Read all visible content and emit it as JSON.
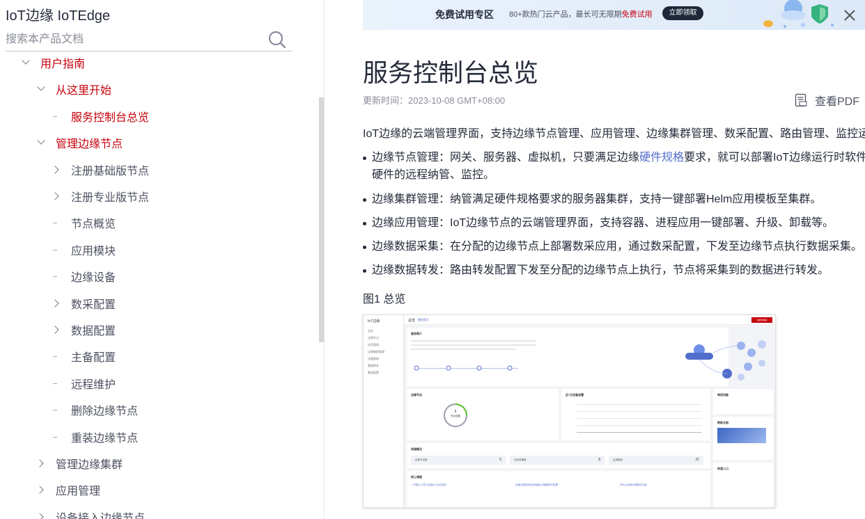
{
  "sidebar": {
    "product_title": "IoT边缘 IoTEdge",
    "search_placeholder": "搜索本产品文档",
    "items": [
      {
        "label": "用户指南",
        "state": "expanded",
        "level": 1,
        "active": true
      },
      {
        "label": "从这里开始",
        "state": "expanded",
        "level": 2,
        "active": true
      },
      {
        "label": "服务控制台总览",
        "state": "leaf",
        "level": 3,
        "active": true
      },
      {
        "label": "管理边缘节点",
        "state": "expanded",
        "level": 2,
        "active": true
      },
      {
        "label": "注册基础版节点",
        "state": "collapsed",
        "level": 3,
        "active": false
      },
      {
        "label": "注册专业版节点",
        "state": "collapsed",
        "level": 3,
        "active": false
      },
      {
        "label": "节点概览",
        "state": "leaf",
        "level": 3,
        "active": false
      },
      {
        "label": "应用模块",
        "state": "leaf",
        "level": 3,
        "active": false
      },
      {
        "label": "边缘设备",
        "state": "leaf",
        "level": 3,
        "active": false
      },
      {
        "label": "数采配置",
        "state": "collapsed",
        "level": 3,
        "active": false
      },
      {
        "label": "数据配置",
        "state": "collapsed",
        "level": 3,
        "active": false
      },
      {
        "label": "主备配置",
        "state": "leaf",
        "level": 3,
        "active": false
      },
      {
        "label": "远程维护",
        "state": "leaf",
        "level": 3,
        "active": false
      },
      {
        "label": "删除边缘节点",
        "state": "leaf",
        "level": 3,
        "active": false
      },
      {
        "label": "重装边缘节点",
        "state": "leaf",
        "level": 3,
        "active": false
      },
      {
        "label": "管理边缘集群",
        "state": "collapsed",
        "level": 2,
        "active": false
      },
      {
        "label": "应用管理",
        "state": "collapsed",
        "level": 2,
        "active": false
      },
      {
        "label": "设备接入边缘节点",
        "state": "collapsed",
        "level": 2,
        "active": false
      }
    ]
  },
  "promo": {
    "title": "免费试用专区",
    "desc_prefix": "80+款热门云产品，最长可无限期",
    "desc_highlight": "免费试用",
    "button": "立即领取"
  },
  "article": {
    "title": "服务控制台总览",
    "update_time": "更新时间：2023-10-08 GMT+08:00",
    "pdf_label": "查看PDF",
    "intro": "IoT边缘的云端管理界面，支持边缘节点管理、应用管理、边缘集群管理、数采配置、路由管理、监控运维",
    "bullets": [
      {
        "before": "边缘节点管理：网关、服务器、虚拟机，只要满足边缘",
        "link": "硬件规格",
        "after": "要求，就可以部署IoT边缘运行时软件，",
        "line2": "硬件的远程纳管、监控。"
      },
      {
        "before": "边缘集群管理：纳管满足硬件规格要求的服务器集群，支持一键部署Helm应用模板至集群。"
      },
      {
        "before": "边缘应用管理：IoT边缘节点的云端管理界面，支持容器、进程应用一键部署、升级、卸载等。"
      },
      {
        "before": "边缘数据采集：在分配的边缘节点上部署数采应用，通过数采配置，下发至边缘节点执行数据采集。"
      },
      {
        "before": "边缘数据转发：路由转发配置下发至分配的边缘节点上执行，节点将采集到的数据进行转发。"
      }
    ],
    "figure_caption": "图1 总览"
  },
  "figure": {
    "side_title": "IoT边缘",
    "side_items": [
      "总览",
      "边缘节点",
      "应用管理",
      "边缘集群管理",
      "设备管理",
      "数据转发",
      "数采配置"
    ],
    "head_title": "总览",
    "head_sub": "服务简介",
    "head_button": "免费体验版",
    "card_intro": "服务简介",
    "card_nodes": "边缘节点",
    "card_nodes_count": "5",
    "card_nodes_unit": "节点总数",
    "card_trend": "近7日设备告警",
    "card_usage": "资源概况",
    "stats": [
      {
        "label": "边缘节点数",
        "value": "5"
      },
      {
        "label": "在线设备数",
        "value": "8"
      },
      {
        "label": "应用模块",
        "value": "21"
      }
    ],
    "card_courses": "线上课程",
    "course_links": [
      "一节课入门学习边缘IoT云边协同",
      "边缘计算如何支持海量IoT数据实时处理",
      "华为云边缘计算解决方案"
    ],
    "right_card1": "常用功能",
    "right_card2": "帮助文档",
    "right_card3": "快速入口"
  }
}
